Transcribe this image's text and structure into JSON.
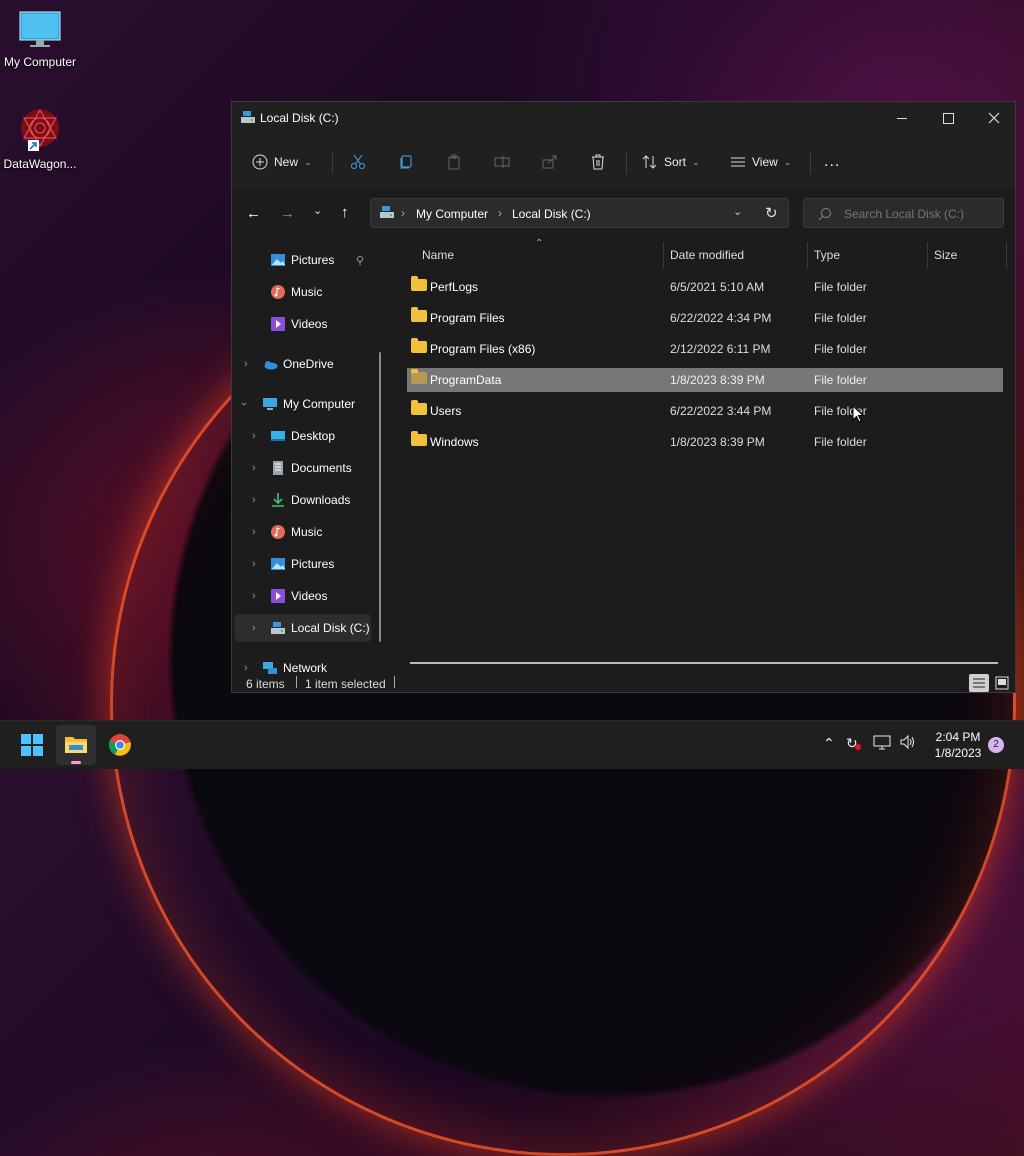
{
  "desktop": {
    "icons": [
      {
        "label": "My Computer",
        "icon": "monitor-icon"
      },
      {
        "label": "DataWagon...",
        "icon": "app-shortcut-icon"
      }
    ]
  },
  "window": {
    "title": "Local Disk (C:)",
    "toolbar": {
      "new_label": "New",
      "sort_label": "Sort",
      "view_label": "View",
      "more_label": "..."
    },
    "address": {
      "crumbs": [
        "My Computer",
        "Local Disk (C:)"
      ]
    },
    "search": {
      "placeholder": "Search Local Disk (C:)"
    },
    "nav": {
      "quick": [
        {
          "label": "Pictures",
          "icon": "pictures-icon"
        },
        {
          "label": "Music",
          "icon": "music-icon"
        },
        {
          "label": "Videos",
          "icon": "videos-icon"
        }
      ],
      "onedrive": "OneDrive",
      "mycomputer": "My Computer",
      "children": [
        {
          "label": "Desktop",
          "icon": "desktop-icon"
        },
        {
          "label": "Documents",
          "icon": "documents-icon"
        },
        {
          "label": "Downloads",
          "icon": "downloads-icon"
        },
        {
          "label": "Music",
          "icon": "music-icon"
        },
        {
          "label": "Pictures",
          "icon": "pictures-icon"
        },
        {
          "label": "Videos",
          "icon": "videos-icon"
        },
        {
          "label": "Local Disk (C:)",
          "icon": "drive-icon"
        }
      ],
      "network": "Network"
    },
    "columns": {
      "name": "Name",
      "date": "Date modified",
      "type": "Type",
      "size": "Size"
    },
    "files": [
      {
        "name": "PerfLogs",
        "date": "6/5/2021 5:10 AM",
        "type": "File folder",
        "selected": false
      },
      {
        "name": "Program Files",
        "date": "6/22/2022 4:34 PM",
        "type": "File folder",
        "selected": false
      },
      {
        "name": "Program Files (x86)",
        "date": "2/12/2022 6:11 PM",
        "type": "File folder",
        "selected": false
      },
      {
        "name": "ProgramData",
        "date": "1/8/2023 8:39 PM",
        "type": "File folder",
        "selected": true
      },
      {
        "name": "Users",
        "date": "6/22/2022 3:44 PM",
        "type": "File folder",
        "selected": false
      },
      {
        "name": "Windows",
        "date": "1/8/2023 8:39 PM",
        "type": "File folder",
        "selected": false
      }
    ],
    "status": {
      "items": "6 items",
      "selected": "1 item selected"
    }
  },
  "taskbar": {
    "time": "2:04 PM",
    "date": "1/8/2023",
    "notification_count": "2"
  }
}
